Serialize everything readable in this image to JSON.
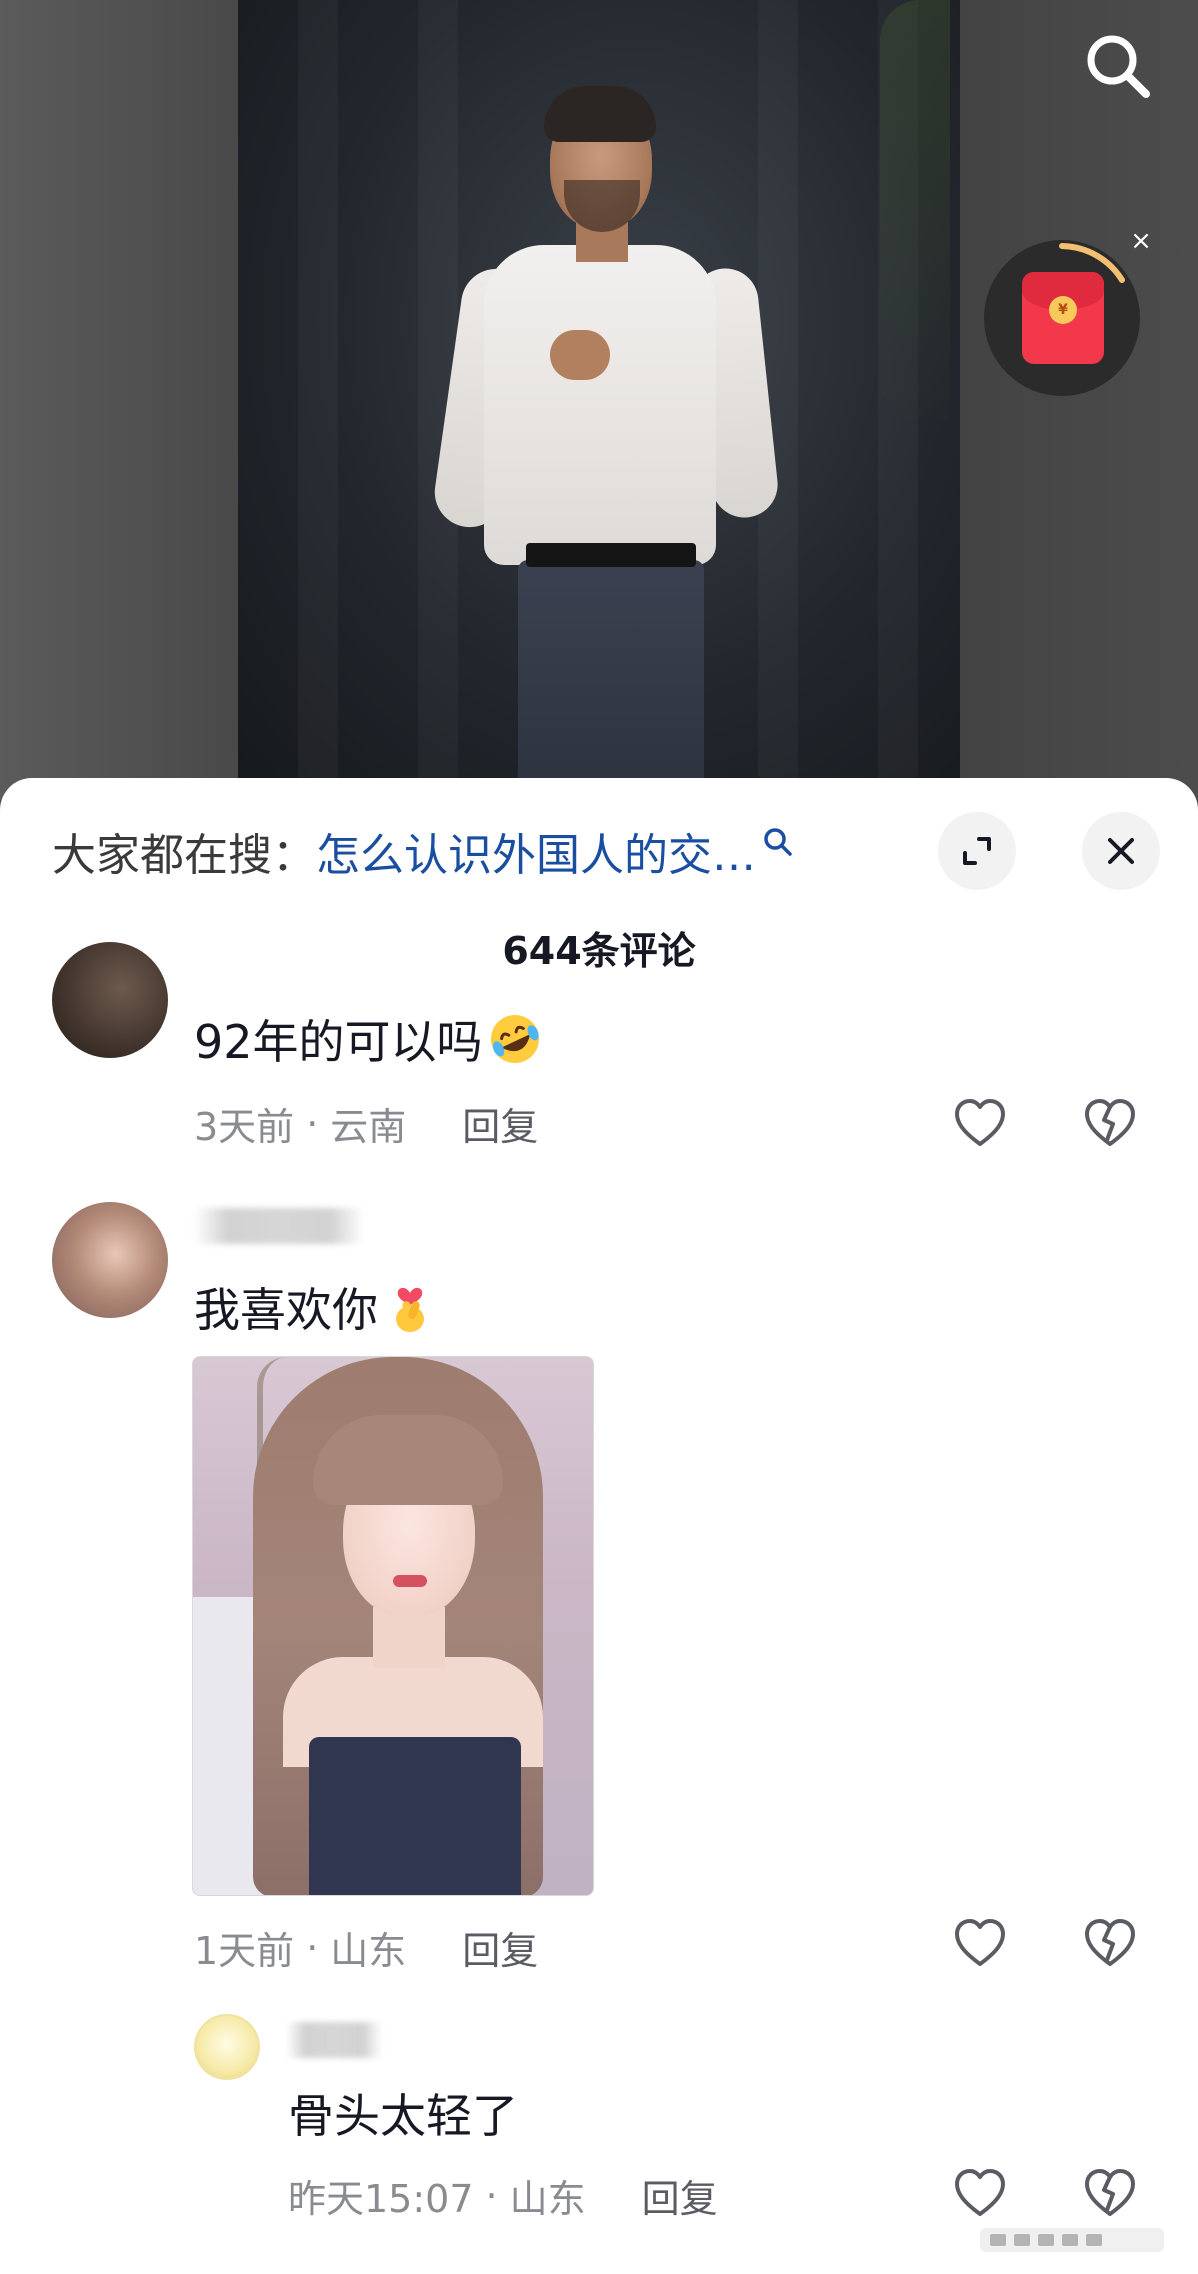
{
  "comments_panel": {
    "search": {
      "prefix": "大家都在搜：",
      "query": "怎么认识外国人的交…"
    },
    "count_title": "644条评论",
    "comments": [
      {
        "text": "92年的可以吗",
        "emoji": "rolling-on-floor-laughing",
        "time": "3天前",
        "location": "云南",
        "reply_label": "回复"
      },
      {
        "text": "我喜欢你",
        "emoji": "finger-heart",
        "time": "1天前",
        "location": "山东",
        "reply_label": "回复",
        "has_photo": true
      }
    ],
    "reply": {
      "text": "骨头太轻了",
      "time": "昨天15:07",
      "location": "山东",
      "reply_label": "回复"
    }
  },
  "separator": "·",
  "red_packet": {
    "symbol": "¥"
  },
  "colors": {
    "link_blue": "#1a4ea0",
    "meta_gray": "#8a8b91",
    "packet_red": "#f2384a"
  }
}
